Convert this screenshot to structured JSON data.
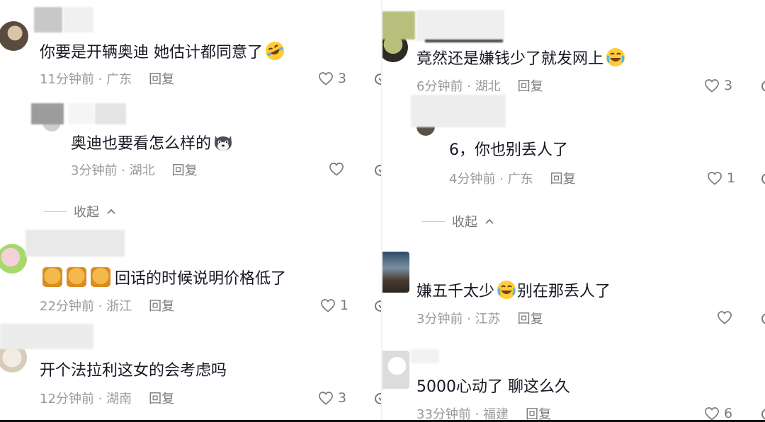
{
  "left": {
    "comments": [
      {
        "text": "你要是开辆奥迪 她估计都同意了",
        "emoji": "rofl-emoji",
        "time": "11分钟前",
        "location": "广东",
        "reply": "回复",
        "likes": "3"
      },
      {
        "text": "奥迪也要看怎么样的",
        "emoji": "husky-emoji",
        "time": "3分钟前",
        "location": "湖北",
        "reply": "回复",
        "likes": ""
      },
      {
        "text": "回话的时候说明价格低了",
        "prefix_emoji": "cat-emoji",
        "time": "22分钟前",
        "location": "浙江",
        "reply": "回复",
        "likes": "1"
      },
      {
        "text": "开个法拉利这女的会考虑吗",
        "time": "12分钟前",
        "location": "湖南",
        "reply": "回复",
        "likes": "3"
      }
    ],
    "collapse_label": "收起"
  },
  "right": {
    "comments": [
      {
        "text": "竟然还是嫌钱少了就发网上",
        "emoji": "crying-laugh-emoji",
        "time": "6分钟前",
        "location": "湖北",
        "reply": "回复",
        "likes": "3"
      },
      {
        "text": "6，你也别丢人了",
        "time": "4分钟前",
        "location": "广东",
        "reply": "回复",
        "likes": "1"
      },
      {
        "text_a": "嫌五千太少",
        "emoji": "crying-laugh-emoji",
        "text_b": "别在那丢人了",
        "time": "3分钟前",
        "location": "江苏",
        "reply": "回复",
        "likes": ""
      },
      {
        "text": "5000心动了  聊这么久",
        "time": "33分钟前",
        "location": "福建",
        "reply": "回复",
        "likes": "6"
      }
    ],
    "collapse_label": "收起"
  },
  "separator": " · ",
  "colors": {
    "text": "#161823",
    "meta": "#9a9a9e",
    "reply": "#7a7a7e"
  }
}
